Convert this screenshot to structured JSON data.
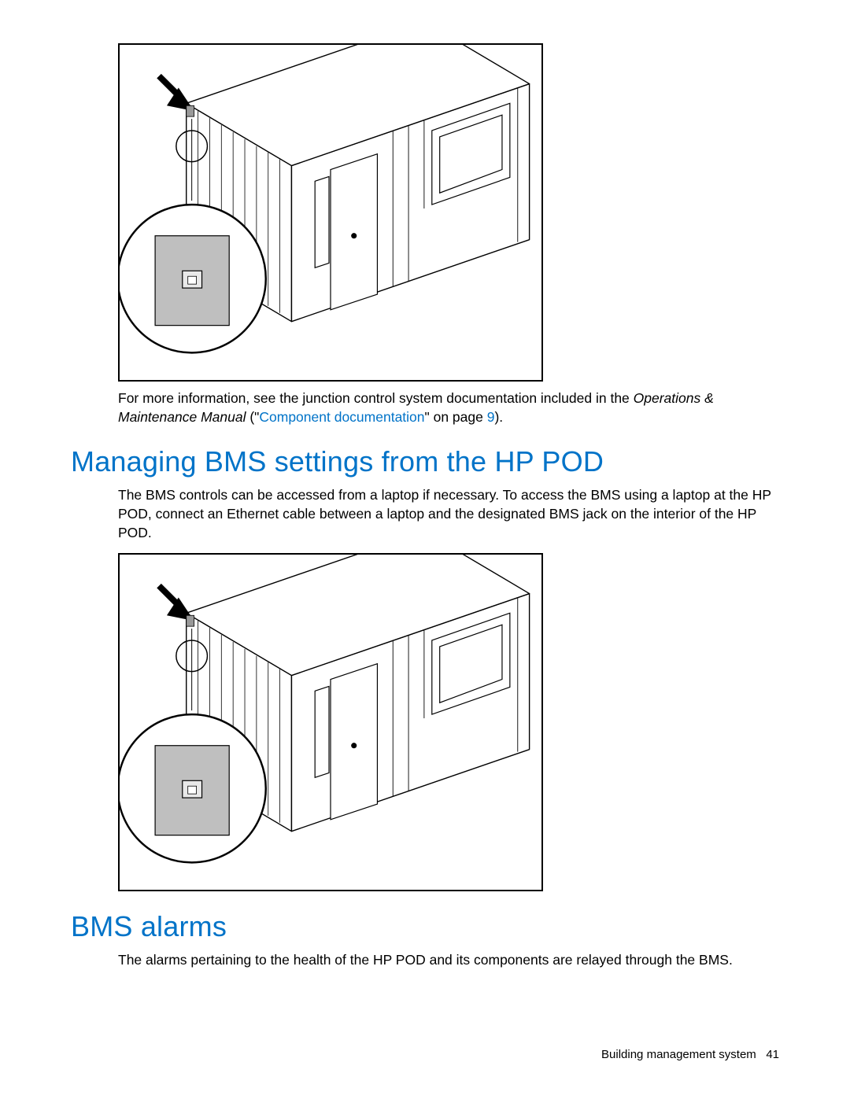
{
  "para1": {
    "prefix": "For more information, see the junction control system documentation included in the ",
    "italic": "Operations & Maintenance Manual",
    "after_italic": " (\"",
    "link": "Component documentation",
    "after_link": "\" on page ",
    "page_ref": "9",
    "suffix": ")."
  },
  "heading1": "Managing BMS settings from the HP POD",
  "para2": "The BMS controls can be accessed from a laptop if necessary. To access the BMS using a laptop at the HP POD, connect an Ethernet cable between a laptop and the designated BMS jack on the interior of the HP POD.",
  "heading2": "BMS alarms",
  "para3": "The alarms pertaining to the health of the HP POD and its components are relayed through the BMS.",
  "footer": {
    "section": "Building management system",
    "page": "41"
  }
}
